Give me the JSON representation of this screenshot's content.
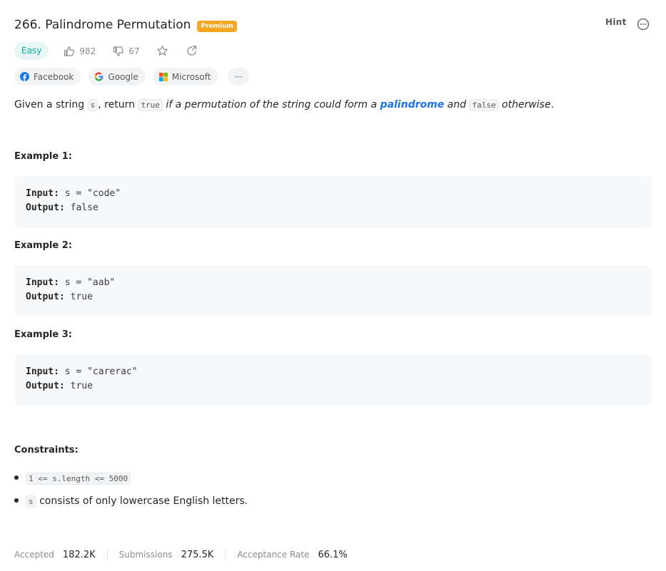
{
  "problem": {
    "title": "266. Palindrome Permutation",
    "premium_badge": "Premium",
    "hint_label": "Hint",
    "difficulty": "Easy",
    "likes": "982",
    "dislikes": "67"
  },
  "companies": {
    "items": [
      "Facebook",
      "Google",
      "Microsoft"
    ],
    "more_label": "···"
  },
  "description": {
    "part1": "Given a string ",
    "code_s": "s",
    "part2": ", return ",
    "code_true": "true",
    "part3": " if a permutation of the string could form a ",
    "link": "palindrome",
    "part4": " and ",
    "code_false": "false",
    "part5": " otherwise",
    "part6": "."
  },
  "examples": [
    {
      "title": "Example 1:",
      "input_label": "Input:",
      "input": "s = \"code\"",
      "output_label": "Output:",
      "output": "false"
    },
    {
      "title": "Example 2:",
      "input_label": "Input:",
      "input": "s = \"aab\"",
      "output_label": "Output:",
      "output": "true"
    },
    {
      "title": "Example 3:",
      "input_label": "Input:",
      "input": "s = \"carerac\"",
      "output_label": "Output:",
      "output": "true"
    }
  ],
  "constraints": {
    "title": "Constraints:",
    "c1_code": "1 <= s.length <= 5000",
    "c2_code": "s",
    "c2_text": " consists of only lowercase English letters."
  },
  "stats": {
    "accepted_label": "Accepted",
    "accepted": "182.2K",
    "submissions_label": "Submissions",
    "submissions": "275.5K",
    "rate_label": "Acceptance Rate",
    "rate": "66.1%"
  },
  "colors": {
    "easy": "#00af9b",
    "premium": "#f5a623",
    "link": "#1a73e8"
  }
}
